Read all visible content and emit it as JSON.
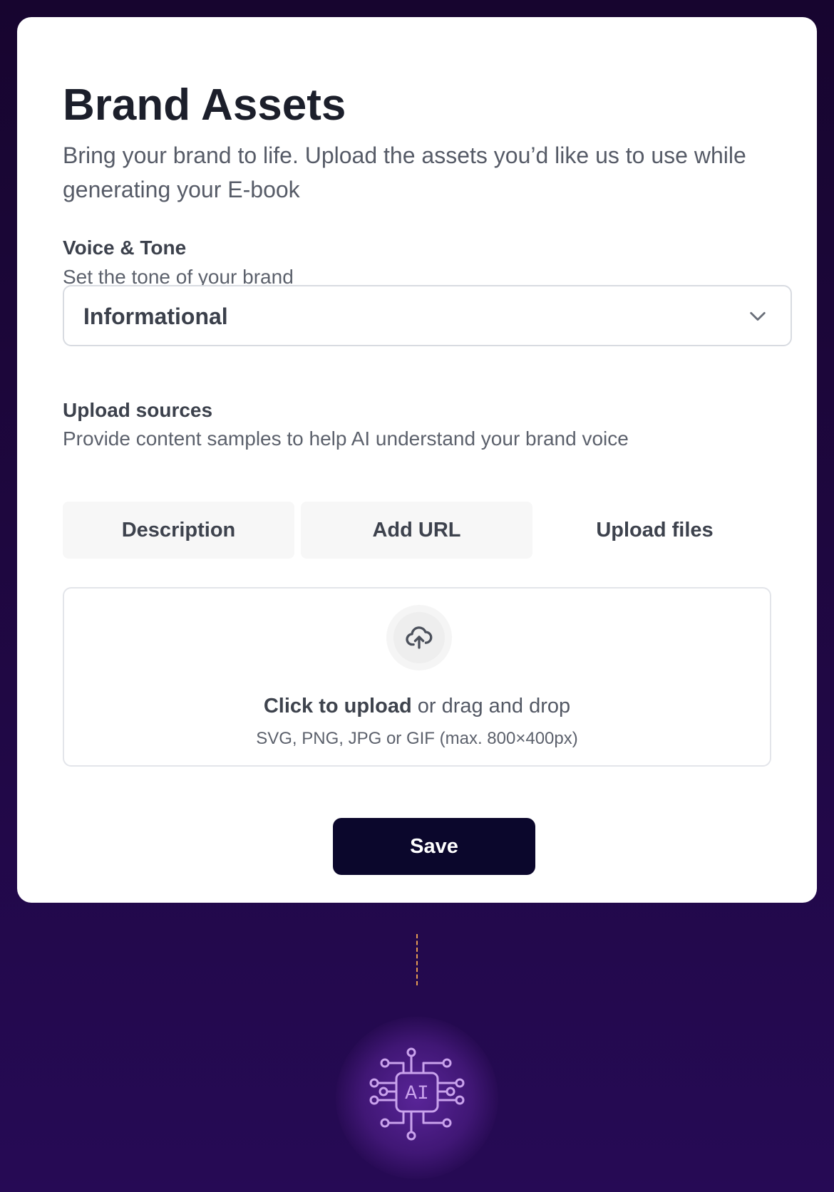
{
  "page": {
    "title": "Brand Assets",
    "subtitle": "Bring your brand to life. Upload the assets you’d like us to use while generating your E-book"
  },
  "voice_tone": {
    "label": "Voice & Tone",
    "help": "Set the tone of your brand",
    "selected": "Informational",
    "icon": "chevron-down-icon"
  },
  "upload_sources": {
    "label": "Upload sources",
    "help": "Provide content samples to help AI understand your brand voice",
    "tabs": [
      {
        "label": "Description"
      },
      {
        "label": "Add URL"
      },
      {
        "label": "Upload files"
      }
    ],
    "active_tab": "Upload files"
  },
  "dropzone": {
    "icon": "upload-cloud-icon",
    "primary": "Click to upload",
    "secondary": " or drag and drop",
    "meta": "SVG, PNG, JPG or GIF (max. 800×400px)"
  },
  "actions": {
    "save": "Save"
  },
  "illustration": {
    "icon_text": "AI",
    "connector_color": "#e59d54",
    "icon_color": "#c9a2ec"
  }
}
